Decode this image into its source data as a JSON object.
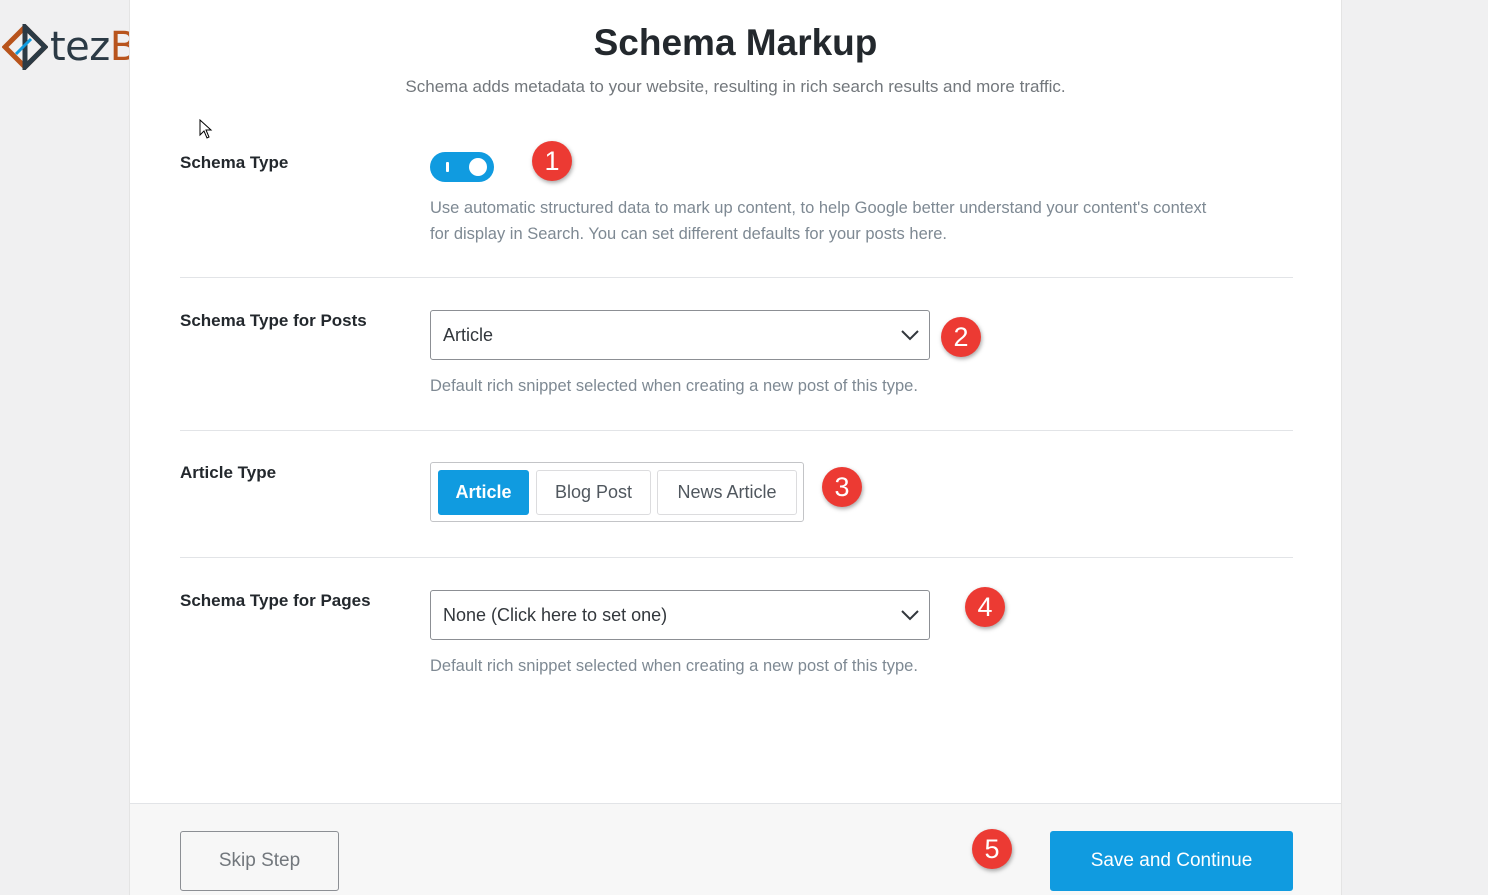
{
  "logo": {
    "part1": "tez",
    "part2": "Blog"
  },
  "header": {
    "title": "Schema Markup",
    "subtitle": "Schema adds metadata to your website, resulting in rich search results and more traffic."
  },
  "schema_type": {
    "label": "Schema Type",
    "toggle_on": true,
    "description_line1": "Use automatic structured data to mark up content, to help Google better understand your content's context",
    "description_line2": "for display in Search. You can set different defaults for your posts here."
  },
  "posts": {
    "label": "Schema Type for Posts",
    "selected": "Article",
    "description": "Default rich snippet selected when creating a new post of this type."
  },
  "article_type": {
    "label": "Article Type",
    "options": [
      "Article",
      "Blog Post",
      "News Article"
    ],
    "selected": "Article"
  },
  "pages": {
    "label": "Schema Type for Pages",
    "selected": "None (Click here to set one)",
    "description": "Default rich snippet selected when creating a new post of this type."
  },
  "markers": [
    "1",
    "2",
    "3",
    "4",
    "5"
  ],
  "footer": {
    "skip_label": "Skip Step",
    "save_label": "Save and Continue"
  },
  "colors": {
    "accent": "#109be0",
    "marker": "#ec3a33",
    "logo_dark": "#2b3a45",
    "logo_orange": "#b8541c"
  }
}
